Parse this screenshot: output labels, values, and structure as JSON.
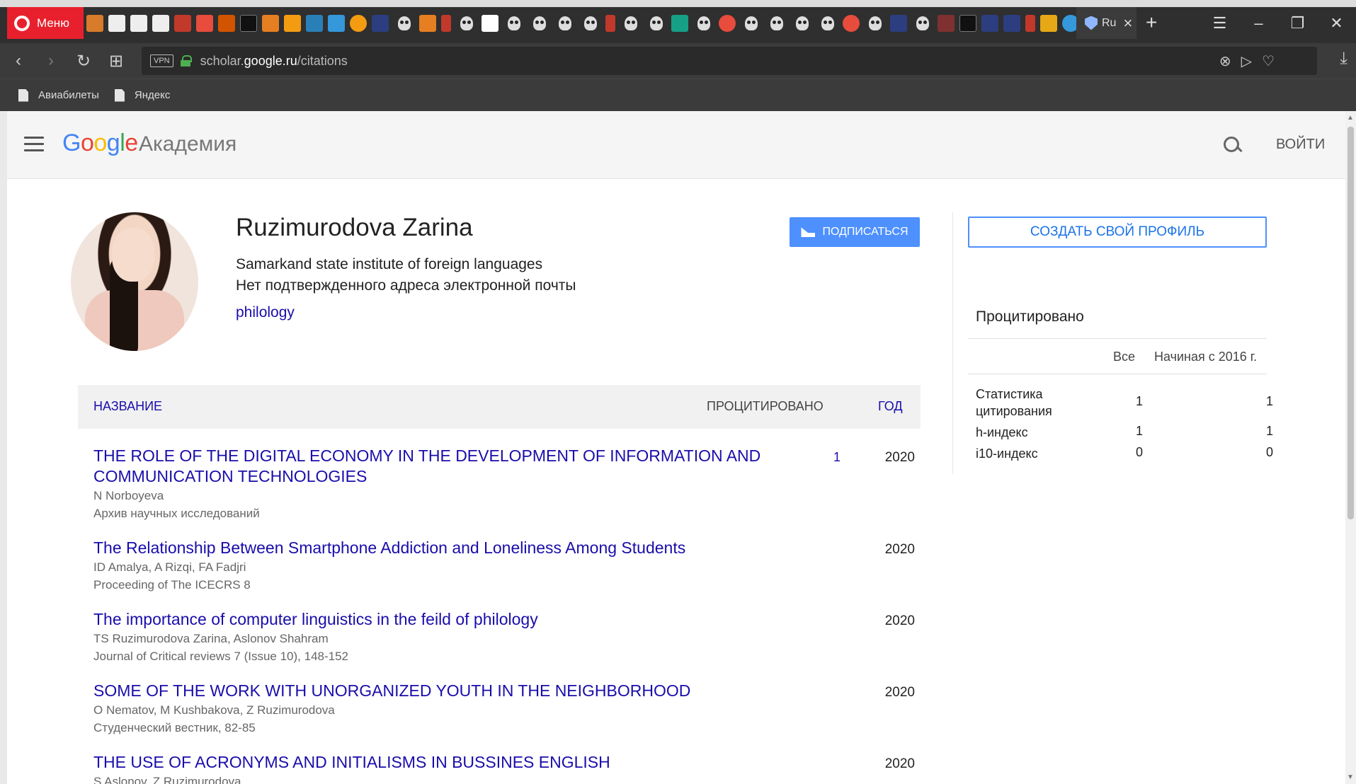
{
  "browser": {
    "menu_label": "Меню",
    "active_tab_label": "Ru",
    "address": {
      "prefix": "scholar.",
      "domain": "google.ru",
      "path": "/citations"
    },
    "vpn_label": "VPN",
    "bookmarks": [
      {
        "label": "Авиабилеты"
      },
      {
        "label": "Яндекс"
      }
    ]
  },
  "header": {
    "logo_google": "Google",
    "logo_sub": "Академия",
    "signin_label": "ВОЙТИ"
  },
  "profile": {
    "name": "Ruzimurodova Zarina",
    "affiliation": "Samarkand state institute of foreign languages",
    "email_status": "Нет подтвержденного адреса электронной почты",
    "interest": "philology",
    "follow_label": "ПОДПИСАТЬСЯ",
    "create_profile_label": "СОЗДАТЬ СВОЙ ПРОФИЛЬ"
  },
  "cited_by": {
    "title": "Процитировано",
    "col_all": "Все",
    "col_since": "Начиная с 2016 г.",
    "rows": [
      {
        "label": "Статистика цитирования",
        "all": "1",
        "since": "1"
      },
      {
        "label": "h-индекс",
        "all": "1",
        "since": "1"
      },
      {
        "label": "i10-индекс",
        "all": "0",
        "since": "0"
      }
    ]
  },
  "table": {
    "col_title": "НАЗВАНИЕ",
    "col_cited": "ПРОЦИТИРОВАНО",
    "col_year": "ГОД"
  },
  "publications": [
    {
      "title": "THE ROLE OF THE DIGITAL ECONOMY IN THE DEVELOPMENT OF INFORMATION AND COMMUNICATION TECHNOLOGIES",
      "authors": "N Norboyeva",
      "venue": "Архив научных исследований",
      "cited": "1",
      "year": "2020"
    },
    {
      "title": "The Relationship Between Smartphone Addiction and Loneliness Among Students",
      "authors": "ID Amalya, A Rizqi, FA Fadjri",
      "venue": "Proceeding of The ICECRS 8",
      "cited": "",
      "year": "2020"
    },
    {
      "title": "The importance of computer linguistics in the feild of philology",
      "authors": "TS Ruzimurodova Zarina, Aslonov Shahram",
      "venue": "Journal of Critical reviews 7 (Issue 10), 148-152",
      "cited": "",
      "year": "2020"
    },
    {
      "title": "SOME OF THE WORK WITH UNORGANIZED YOUTH IN THE NEIGHBORHOOD",
      "authors": "O Nematov, M Kushbakova, Z Ruzimurodova",
      "venue": "Студенческий вестник, 82-85",
      "cited": "",
      "year": "2020"
    },
    {
      "title": "THE USE OF ACRONYMS AND INITIALISMS IN BUSSINES ENGLISH",
      "authors": "S Aslonov, Z Ruzimurodova",
      "venue": "",
      "cited": "",
      "year": "2020"
    }
  ]
}
